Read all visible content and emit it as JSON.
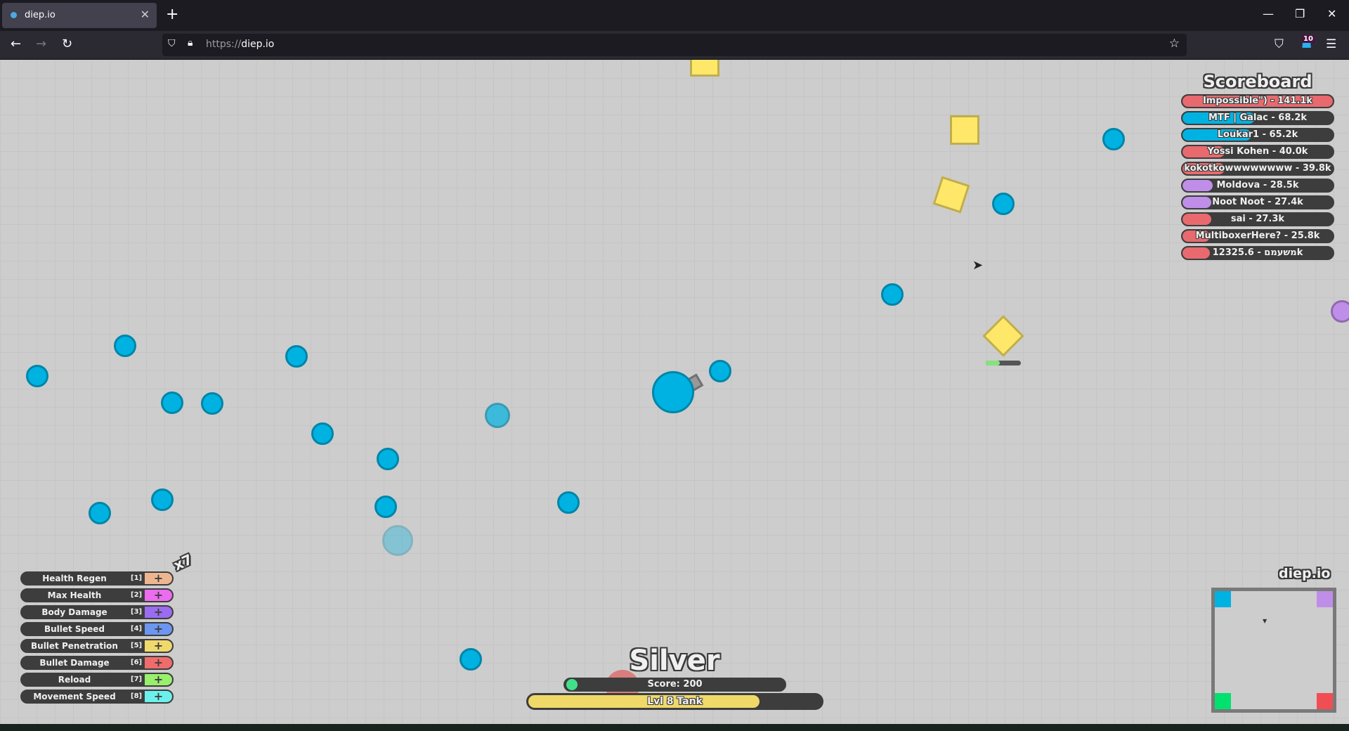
{
  "browser": {
    "tab_title": "diep.io",
    "url_prefix": "https://",
    "url_domain": "diep.io",
    "extension_badge": "10"
  },
  "game": {
    "scoreboard": {
      "title": "Scoreboard",
      "entries": [
        {
          "label": "Impossible\") - 141.1k",
          "color": "#e86a6f",
          "fill": 1.0
        },
        {
          "label": "MTF | Galac - 68.2k",
          "color": "#00b2e1",
          "fill": 0.48
        },
        {
          "label": "Loukar1 - 65.2k",
          "color": "#00b2e1",
          "fill": 0.46
        },
        {
          "label": "Yossi Kohen - 40.0k",
          "color": "#e86a6f",
          "fill": 0.28
        },
        {
          "label": "kokotkowwwwwwww - 39.8k",
          "color": "#e86a6f",
          "fill": 0.28
        },
        {
          "label": "Moldova - 28.5k",
          "color": "#bf8ee8",
          "fill": 0.2
        },
        {
          "label": "Noot Noot - 27.4k",
          "color": "#bf8ee8",
          "fill": 0.19
        },
        {
          "label": "sai - 27.3k",
          "color": "#e86a6f",
          "fill": 0.19
        },
        {
          "label": "MultiboxerHere? - 25.8k",
          "color": "#e86a6f",
          "fill": 0.18
        },
        {
          "label": "123משעמם - 25.6k",
          "color": "#e86a6f",
          "fill": 0.18
        }
      ]
    },
    "upgrades": {
      "points": "x7",
      "stats": [
        {
          "name": "Health Regen",
          "key": "[1]",
          "color": "#eeb690"
        },
        {
          "name": "Max Health",
          "key": "[2]",
          "color": "#ec6cf0"
        },
        {
          "name": "Body Damage",
          "key": "[3]",
          "color": "#9a6cf0"
        },
        {
          "name": "Bullet Speed",
          "key": "[4]",
          "color": "#6c96f0"
        },
        {
          "name": "Bullet Penetration",
          "key": "[5]",
          "color": "#f0d96c"
        },
        {
          "name": "Bullet Damage",
          "key": "[6]",
          "color": "#f06c6c"
        },
        {
          "name": "Reload",
          "key": "[7]",
          "color": "#98f06c"
        },
        {
          "name": "Movement Speed",
          "key": "[8]",
          "color": "#6cf0ec"
        }
      ],
      "plus": "+"
    },
    "player": {
      "name": "Silver",
      "score": "Score: 200",
      "level": "Lvl 8 Tank",
      "level_progress": 0.79
    },
    "minimap": {
      "label": "diep.io",
      "corners": [
        "#00b2e1",
        "#bf8ee8",
        "#00e16e",
        "#f14e54"
      ]
    }
  }
}
